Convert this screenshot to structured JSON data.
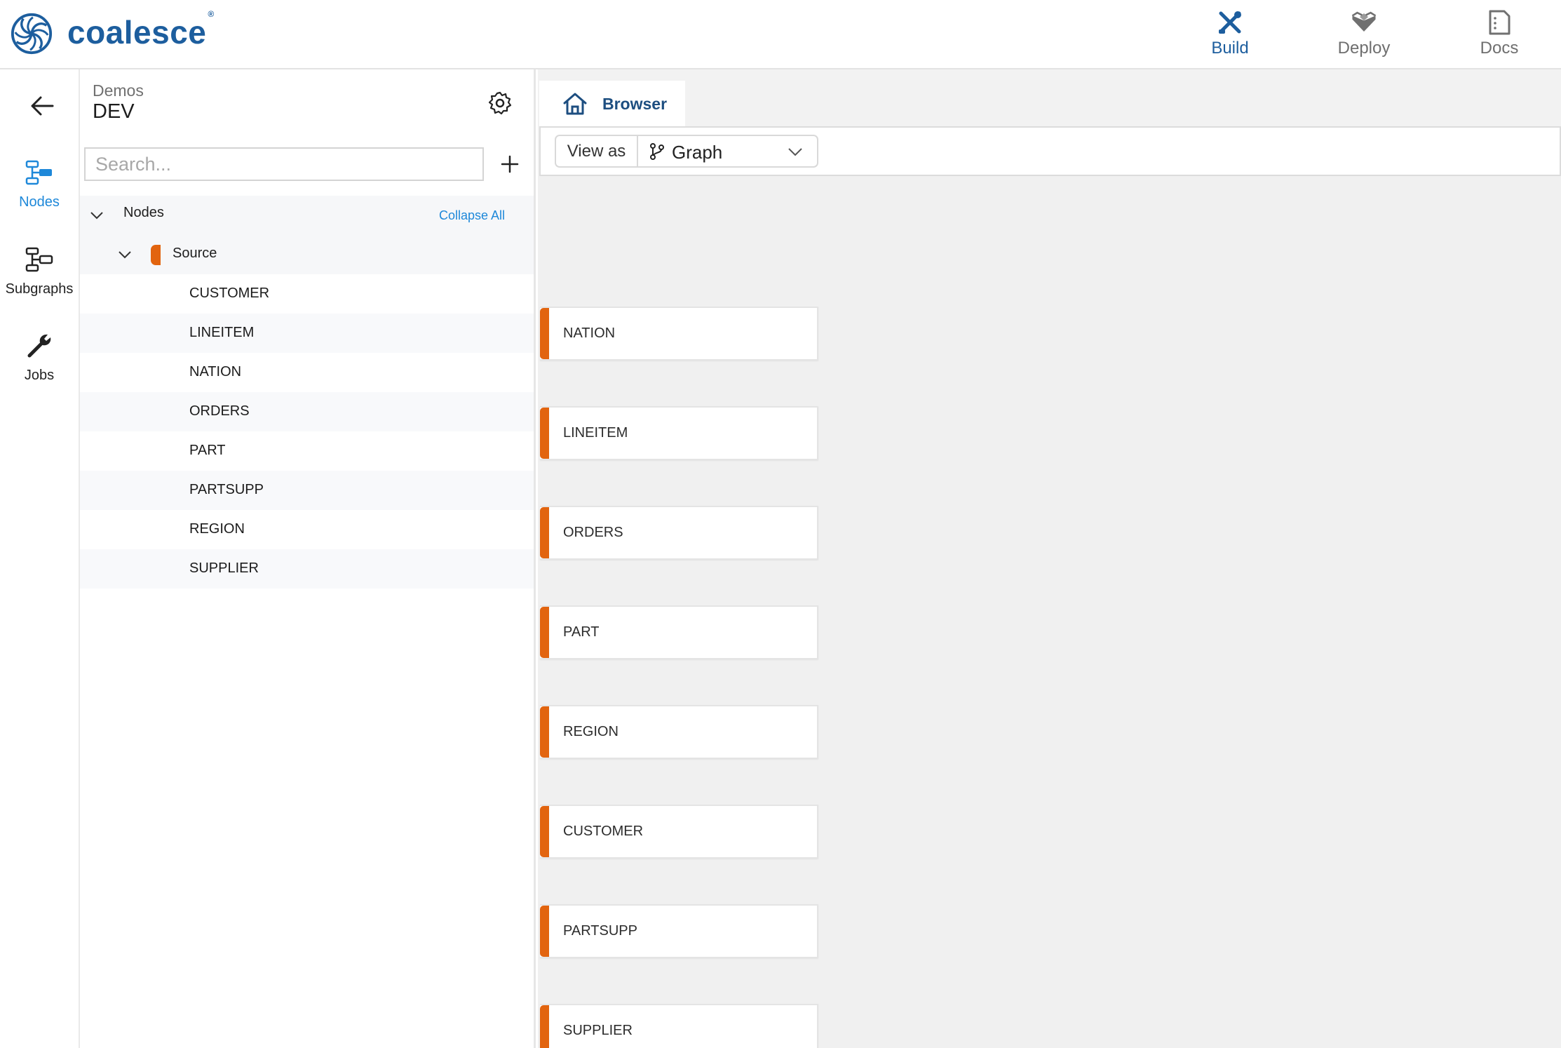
{
  "brand": {
    "name": "coalesce",
    "mark": "®"
  },
  "topnav": [
    {
      "id": "build",
      "label": "Build",
      "icon": "build-icon",
      "active": true
    },
    {
      "id": "deploy",
      "label": "Deploy",
      "icon": "deploy-icon",
      "active": false
    },
    {
      "id": "docs",
      "label": "Docs",
      "icon": "docs-icon",
      "active": false
    }
  ],
  "rail": [
    {
      "id": "nodes",
      "label": "Nodes",
      "icon": "nodes-icon",
      "active": true
    },
    {
      "id": "subgraphs",
      "label": "Subgraphs",
      "icon": "subgraphs-icon",
      "active": false
    },
    {
      "id": "jobs",
      "label": "Jobs",
      "icon": "wrench-icon",
      "active": false
    }
  ],
  "workspace": {
    "project": "Demos",
    "environment": "DEV"
  },
  "search": {
    "placeholder": "Search...",
    "value": ""
  },
  "tree": {
    "root_label": "Nodes",
    "collapse_label": "Collapse All",
    "group_label": "Source",
    "items": [
      "CUSTOMER",
      "LINEITEM",
      "NATION",
      "ORDERS",
      "PART",
      "PARTSUPP",
      "REGION",
      "SUPPLIER"
    ]
  },
  "tab": {
    "label": "Browser",
    "icon": "home-icon"
  },
  "view_as": {
    "label": "View as",
    "value": "Graph"
  },
  "graph_nodes": [
    "NATION",
    "LINEITEM",
    "ORDERS",
    "PART",
    "REGION",
    "CUSTOMER",
    "PARTSUPP",
    "SUPPLIER"
  ],
  "colors": {
    "accent": "#1e88d9",
    "brand": "#1d5e9e",
    "source_tag": "#e2640f"
  }
}
